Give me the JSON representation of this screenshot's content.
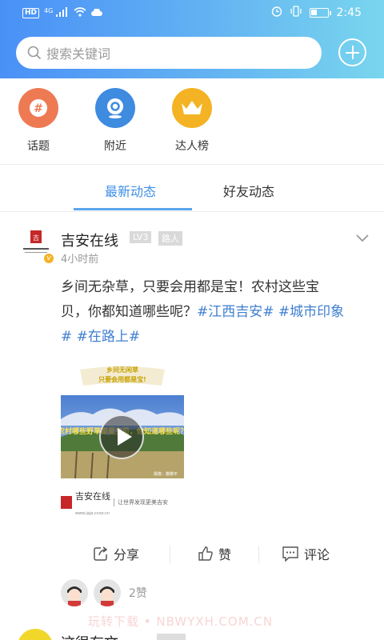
{
  "statusbar": {
    "network_badge": "HD",
    "network_gen": "4G",
    "time": "2:45"
  },
  "search": {
    "placeholder": "搜索关键词"
  },
  "categories": [
    {
      "label": "话题",
      "icon": "hashtag-icon",
      "color": "#ee7a54"
    },
    {
      "label": "附近",
      "icon": "location-icon",
      "color": "#3e8be0"
    },
    {
      "label": "达人榜",
      "icon": "crown-icon",
      "color": "#f4b324"
    }
  ],
  "tabs": {
    "active": "最新动态",
    "inactive": "好友动态"
  },
  "post": {
    "author": "吉安在线",
    "level": "LV3",
    "role": "路人",
    "time": "4小时前",
    "text_line1": "乡间无杂草，只要会用都是宝！农村这些宝",
    "text_line2_plain": "贝，你都知道哪些呢？",
    "tag1": "#江西吉安#",
    "tag2": "#城市印象",
    "tag2_end": "#",
    "tag3": "#在路上#",
    "media": {
      "banner_line1": "乡间无闲草",
      "banner_line2": "只要会用都是宝!",
      "video_caption": "农村哪些野草都是宝贝，你知道哪些呢？",
      "credit": "摄像：撒撒平",
      "logo_text": "吉安在线",
      "logo_url": "www.jaja.ccoo.cn",
      "slogan": "让世界发现更美吉安"
    },
    "actions": {
      "share": "分享",
      "like": "赞",
      "comment": "评论"
    },
    "like_count": "2赞"
  },
  "watermark": "玩转下载 • NBWYXH.COM.CN",
  "next_post": {
    "author": "这很有文"
  },
  "colors": {
    "accent": "#3f8fe8",
    "hashtag": "#3f7fcf",
    "header_gradient_start": "#4a90f7",
    "header_gradient_end": "#79d6ee"
  }
}
